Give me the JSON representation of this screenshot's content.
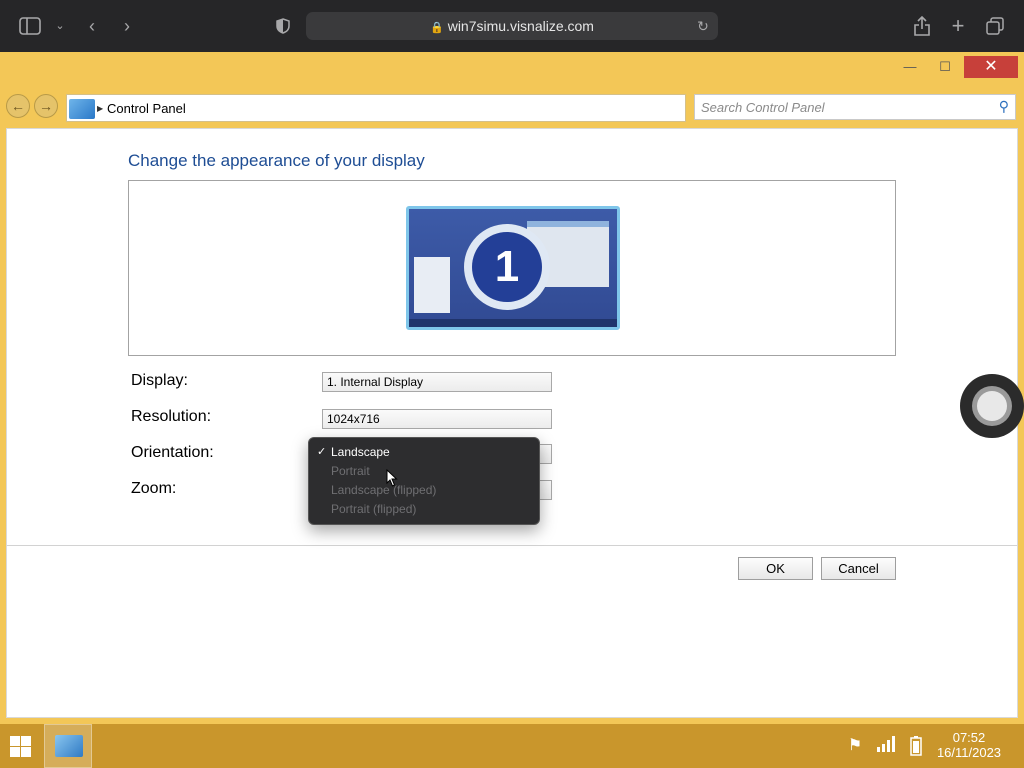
{
  "browser": {
    "url": "win7simu.visnalize.com"
  },
  "window": {
    "minimize_glyph": "—",
    "maximize_glyph": "☐",
    "close_glyph": "✕"
  },
  "address_bar": {
    "breadcrumb": "Control Panel"
  },
  "search": {
    "placeholder": "Search Control Panel"
  },
  "page": {
    "title": "Change the appearance of your display",
    "monitor_number": "1"
  },
  "fields": {
    "display_label": "Display:",
    "display_value": "1. Internal Display",
    "resolution_label": "Resolution:",
    "resolution_value": "1024x716",
    "orientation_label": "Orientation:",
    "zoom_label": "Zoom:"
  },
  "orientation_menu": {
    "options": [
      "Landscape",
      "Portrait",
      "Landscape (flipped)",
      "Portrait (flipped)"
    ],
    "selected": "Landscape",
    "check_glyph": "✓"
  },
  "buttons": {
    "ok": "OK",
    "cancel": "Cancel"
  },
  "taskbar": {
    "time": "07:52",
    "date": "16/11/2023"
  },
  "colors": {
    "title_blue": "#1e4d94",
    "taskbar": "#c9962c",
    "window_frame": "#f3c757"
  }
}
